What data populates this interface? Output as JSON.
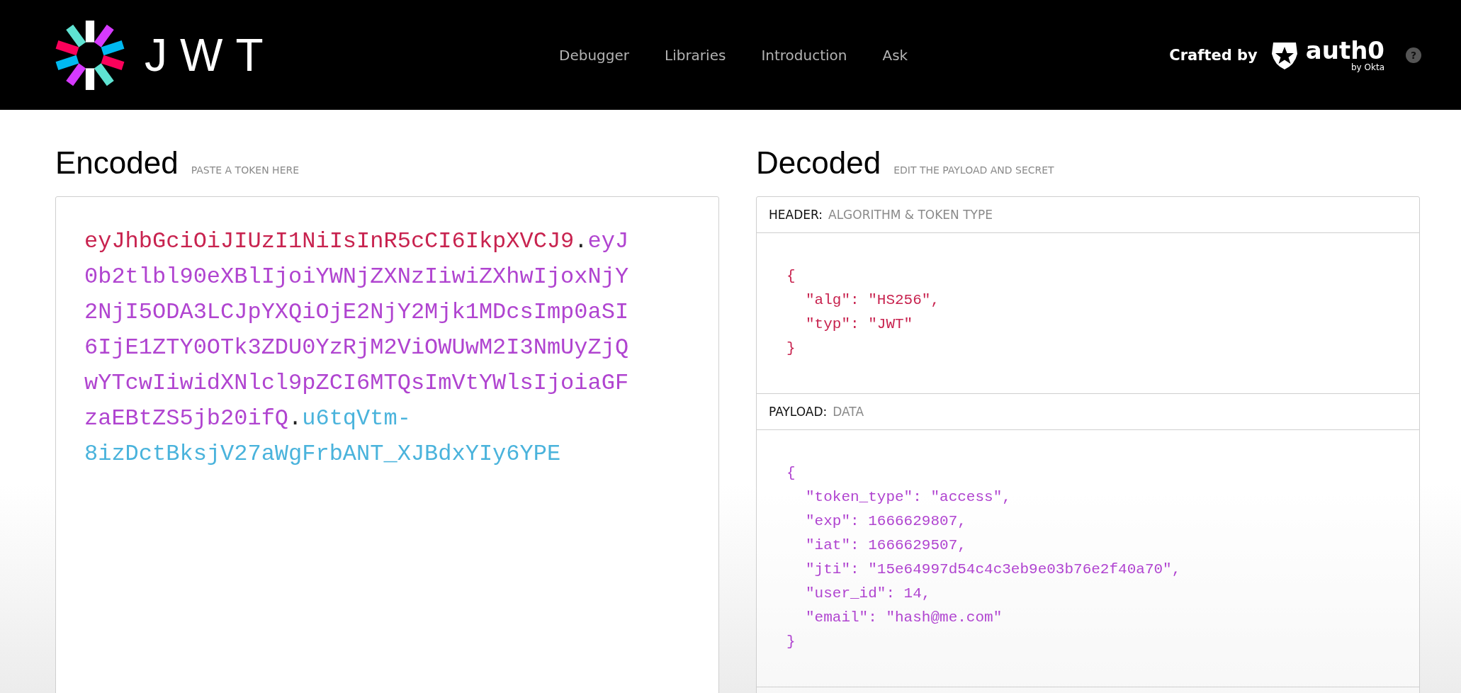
{
  "brand": {
    "wordmark": "JWT"
  },
  "nav": [
    {
      "label": "Debugger"
    },
    {
      "label": "Libraries"
    },
    {
      "label": "Introduction"
    },
    {
      "label": "Ask"
    }
  ],
  "crafted": {
    "label": "Crafted by",
    "logo_text": "auth0",
    "sub": "by Okta",
    "help": "?"
  },
  "encoded": {
    "title": "Encoded",
    "hint": "PASTE A TOKEN HERE",
    "segments": [
      {
        "kind": "header",
        "text": "eyJhbGciOiJIUzI1NiIsInR5cCI6IkpXVCJ9",
        "color": "#c8234f"
      },
      {
        "kind": "dot",
        "text": "."
      },
      {
        "kind": "payload",
        "text": "eyJ0b2tlbl90eXBlIjoiYWNjZXNzIiwiZXhwIjoxNjY2NjI5ODA3LCJpYXQiOjE2NjY2Mjk1MDcsImp0aSI6IjE1ZTY0OTk3ZDU0YzRjM2ViOWUwM2I3NmUyZjQwYTcwIiwidXNlcl9pZCI6MTQsImVtYWlsIjoiaGFzaEBtZS5jb20ifQ",
        "color": "#b044d0"
      },
      {
        "kind": "dot",
        "text": "."
      },
      {
        "kind": "signature",
        "text": "u6tqVtm-8izDctBksjV27aWgFrbANT_XJBdxYIy6YPE",
        "color": "#4ab3dc"
      }
    ]
  },
  "decoded": {
    "title": "Decoded",
    "hint": "EDIT THE PAYLOAD AND SECRET",
    "sections": [
      {
        "label": "HEADER:",
        "sub": "ALGORITHM & TOKEN TYPE",
        "color": "#c8234f",
        "open": "{",
        "entries": [
          "\"alg\": \"HS256\",",
          "\"typ\": \"JWT\""
        ],
        "close": "}"
      },
      {
        "label": "PAYLOAD:",
        "sub": "DATA",
        "color": "#b044d0",
        "open": "{",
        "entries": [
          "\"token_type\": \"access\",",
          "\"exp\": 1666629807,",
          "\"iat\": 1666629507,",
          "\"jti\": \"15e64997d54c4c3eb9e03b76e2f40a70\",",
          "\"user_id\": 14,",
          "\"email\": \"hash@me.com\""
        ],
        "close": "}"
      }
    ]
  }
}
